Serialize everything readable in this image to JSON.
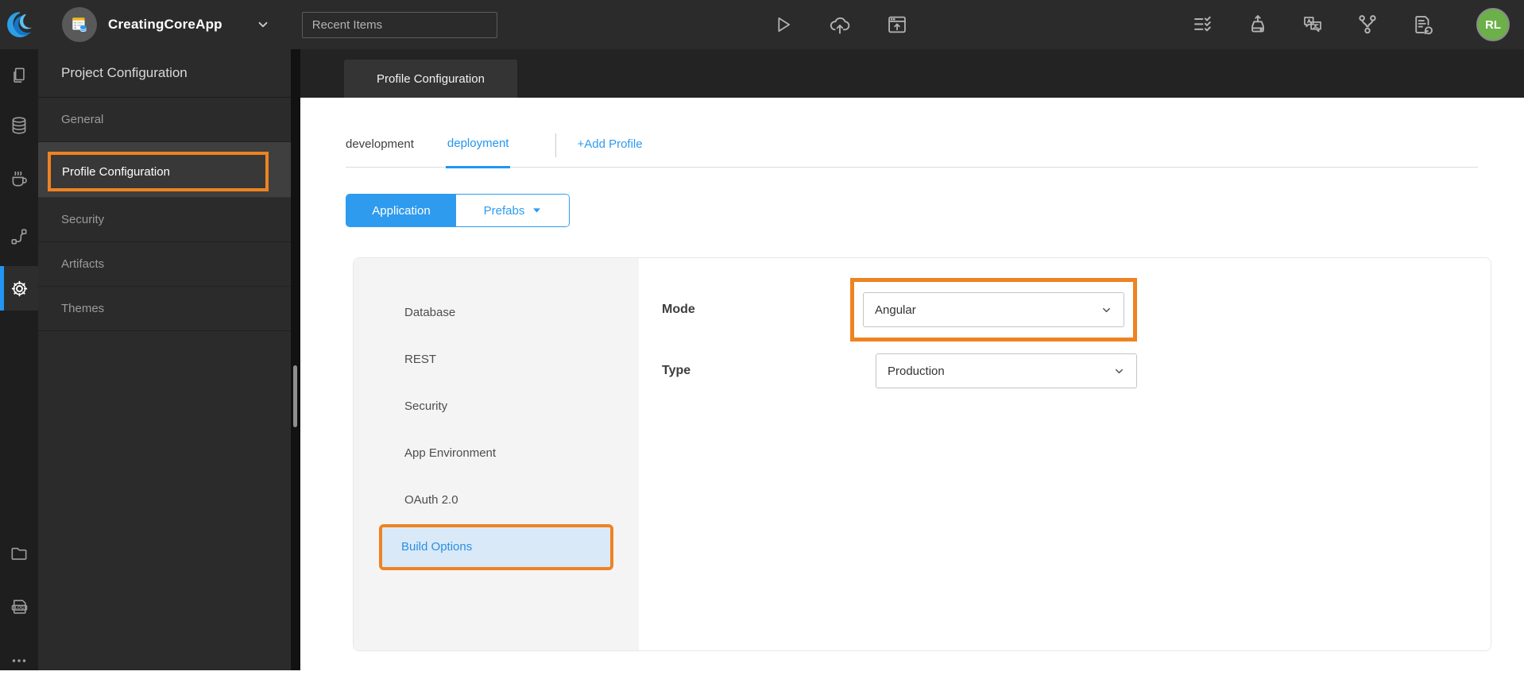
{
  "topbar": {
    "app_name": "CreatingCoreApp",
    "search_placeholder": "Recent Items",
    "avatar_initials": "RL"
  },
  "sidebar": {
    "title": "Project Configuration",
    "items": [
      {
        "label": "General"
      },
      {
        "label": "Profile Configuration",
        "active": true,
        "annotated": true
      },
      {
        "label": "Security"
      },
      {
        "label": "Artifacts"
      },
      {
        "label": "Themes"
      }
    ]
  },
  "main": {
    "page_tab": "Profile Configuration",
    "profile_tabs": [
      {
        "label": "development",
        "active": false
      },
      {
        "label": "deployment",
        "active": true
      }
    ],
    "add_profile_label": "+Add Profile",
    "scope_toggle": {
      "application": "Application",
      "prefabs": "Prefabs",
      "selected": "Application"
    },
    "config_menu": [
      {
        "label": "Database"
      },
      {
        "label": "REST"
      },
      {
        "label": "Security"
      },
      {
        "label": "App Environment"
      },
      {
        "label": "OAuth 2.0"
      },
      {
        "label": "Build Options",
        "active": true,
        "annotated": true
      }
    ],
    "form": {
      "mode_label": "Mode",
      "mode_value": "Angular",
      "type_label": "Type",
      "type_value": "Production"
    }
  },
  "colors": {
    "accent_blue": "#2196f3",
    "toggle_blue": "#2e9bef",
    "annotation_orange": "#ee8322",
    "avatar_green": "#6cb049",
    "active_menu_bg": "#d9e9f7"
  }
}
